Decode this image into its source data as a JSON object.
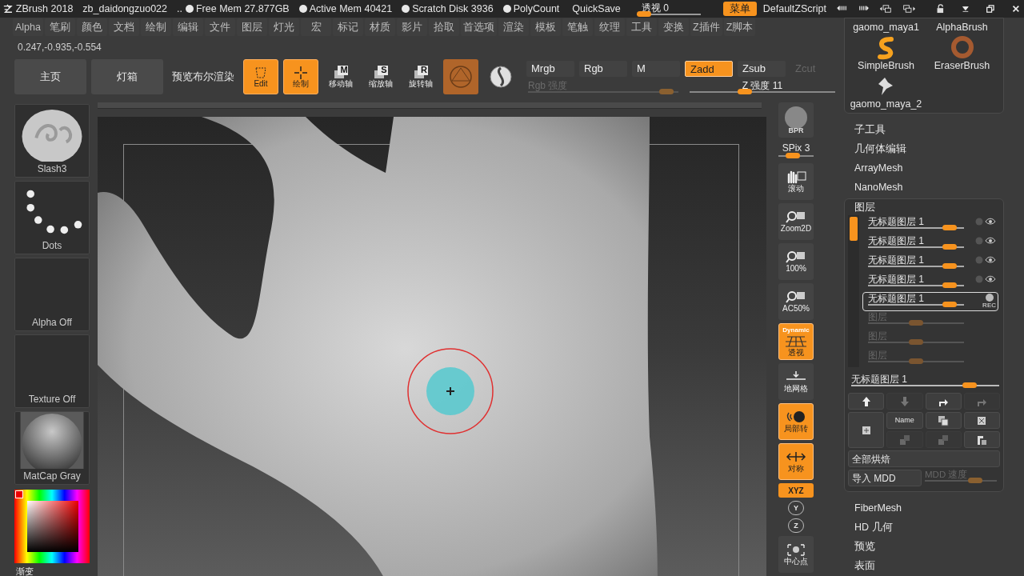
{
  "title_bar": {
    "app": "ZBrush 2018",
    "file": "zb_daidongzuo022",
    "ellipsis": "..",
    "stats": [
      "Free Mem 27.877GB",
      "Active Mem 40421",
      "Scratch Disk 3936",
      "PolyCount"
    ],
    "quicksave": "QuickSave",
    "perspective": {
      "label": "透视",
      "value": "0",
      "level": 0.12
    },
    "menu_button": {
      "label": "菜单",
      "selected": true
    },
    "script": "DefaultZScript"
  },
  "menu": [
    "Alpha",
    "笔刷",
    "颜色",
    "文档",
    "绘制",
    "编辑",
    "文件",
    "图层",
    "灯光",
    "宏",
    "标记",
    "材质",
    "影片",
    "拾取",
    "首选项",
    "渲染",
    "模板",
    "笔触",
    "纹理",
    "工具",
    "变换",
    "Z插件",
    "Z脚本"
  ],
  "coordinates": "0.247,-0.935,-0.554",
  "toolbar": [
    {
      "kind": "text",
      "label": "主页",
      "selected": false
    },
    {
      "kind": "text",
      "label": "灯箱",
      "selected": false
    },
    {
      "kind": "plain",
      "label": "预览布尔渲染",
      "selected": false
    },
    {
      "kind": "edit",
      "label": "Edit",
      "selected": true
    },
    {
      "kind": "draw",
      "label": "绘制",
      "selected": true
    },
    {
      "kind": "axis",
      "glyph": "M",
      "label": "移动轴",
      "selected": false
    },
    {
      "kind": "axis",
      "glyph": "S",
      "label": "缩放轴",
      "selected": false
    },
    {
      "kind": "axis",
      "glyph": "R",
      "label": "旋转轴",
      "selected": false
    },
    {
      "kind": "material",
      "selected": true
    },
    {
      "kind": "material",
      "selected": false
    }
  ],
  "modes": [
    {
      "label": "Mrgb",
      "selected": false,
      "disabled": false
    },
    {
      "label": "Rgb",
      "selected": false,
      "disabled": false
    },
    {
      "label": "M",
      "selected": false,
      "disabled": false
    },
    {
      "label": "Zadd",
      "selected": true,
      "disabled": false
    },
    {
      "label": "Zsub",
      "selected": false,
      "disabled": false
    },
    {
      "label": "Zcut",
      "selected": false,
      "disabled": true
    }
  ],
  "sliders": [
    {
      "label": "Rgb 强度",
      "disabled": true,
      "level": 0.92
    },
    {
      "label": "Z 强度 11",
      "disabled": false,
      "level": 0.38
    }
  ],
  "left_palette": [
    {
      "kind": "brush",
      "label": "Slash3"
    },
    {
      "kind": "stroke",
      "label": "Dots"
    },
    {
      "kind": "empty",
      "label": "Alpha Off"
    },
    {
      "kind": "empty",
      "label": "Texture Off"
    },
    {
      "kind": "material",
      "label": "MatCap Gray"
    }
  ],
  "color_picker": {
    "label": "渐变"
  },
  "right_tools": [
    {
      "kind": "bpr",
      "label": "BPR"
    },
    {
      "kind": "slider",
      "label": "SPix 3",
      "level": 0.4
    },
    {
      "kind": "hand",
      "label": "滚动",
      "selected": false
    },
    {
      "kind": "zoom",
      "label": "Zoom2D",
      "selected": false
    },
    {
      "kind": "zoom",
      "label": "100%",
      "selected": false
    },
    {
      "kind": "zoom",
      "label": "AC50%",
      "selected": false
    },
    {
      "kind": "grid",
      "label": "透视",
      "tag": "Dynamic",
      "selected": true
    },
    {
      "kind": "floor",
      "label": "地网格",
      "selected": false
    },
    {
      "kind": "ball",
      "label": "局部转",
      "selected": true
    },
    {
      "kind": "sym",
      "label": "对称",
      "selected": true
    },
    {
      "kind": "small",
      "label": "XYZ",
      "selected": true
    },
    {
      "kind": "rotate",
      "label": "Y"
    },
    {
      "kind": "rotate",
      "label": "Z"
    },
    {
      "kind": "center",
      "label": "中心点",
      "selected": false
    }
  ],
  "brushes": [
    {
      "kind": "text",
      "label": "gaomo_maya1"
    },
    {
      "kind": "text",
      "label": "AlphaBrush"
    },
    {
      "kind": "simple",
      "label": "SimpleBrush"
    },
    {
      "kind": "eraser",
      "label": "EraserBrush"
    },
    {
      "kind": "maya",
      "label": "gaomo_maya_2"
    }
  ],
  "tool_items_top": [
    "子工具",
    "几何体编辑",
    "ArrayMesh",
    "NanoMesh"
  ],
  "layers": {
    "title": "图层",
    "record_label": "REC",
    "items": [
      {
        "name": "无标题图层 1",
        "selected": false,
        "level": 0.85
      },
      {
        "name": "无标题图层 1",
        "selected": false,
        "level": 0.85
      },
      {
        "name": "无标题图层 1",
        "selected": false,
        "level": 0.85
      },
      {
        "name": "无标题图层 1",
        "selected": false,
        "level": 0.85
      },
      {
        "name": "无标题图层 1",
        "selected": true,
        "level": 0.85
      }
    ],
    "empty_slots": [
      {
        "name": "图层",
        "level": 0.5
      },
      {
        "name": "图层",
        "level": 0.5
      },
      {
        "name": "图层",
        "level": 0.5
      }
    ],
    "current": {
      "name": "无标题图层 1",
      "level": 0.8
    },
    "buttons": [
      {
        "kind": "up",
        "disabled": false
      },
      {
        "kind": "down",
        "disabled": true
      },
      {
        "kind": "turn",
        "disabled": false
      },
      {
        "kind": "turn",
        "disabled": true
      },
      {
        "kind": "new",
        "disabled": false
      },
      {
        "kind": "name",
        "label": "Name",
        "disabled": false
      },
      {
        "kind": "copy",
        "disabled": false
      },
      {
        "kind": "delete",
        "disabled": false
      },
      {
        "kind": "merge",
        "disabled": true
      },
      {
        "kind": "merge",
        "disabled": true
      },
      {
        "kind": "insert",
        "disabled": false
      }
    ],
    "bake": "全部烘焙",
    "import": "导入 MDD",
    "speed": {
      "label": "MDD 速度",
      "level": 0.7
    }
  },
  "tool_items_bottom": [
    "FiberMesh",
    "HD 几何",
    "预览",
    "表面"
  ]
}
